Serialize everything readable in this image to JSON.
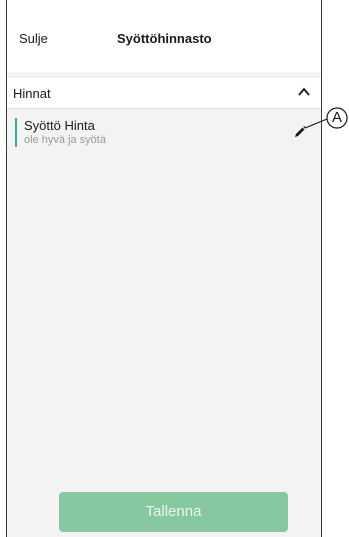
{
  "header": {
    "close_label": "Sulje",
    "title": "Syöttöhinnasto"
  },
  "section": {
    "title": "Hinnat",
    "chevron_icon": "chevron-up-icon"
  },
  "item": {
    "title": "Syöttö Hinta",
    "subtitle": "ole hyvä ja syötä",
    "accent_color": "#3aa9a0",
    "edit_icon": "pencil-icon"
  },
  "callout": {
    "label": "A"
  },
  "footer": {
    "save_label": "Tallenna",
    "save_color": "#86c8a0"
  }
}
